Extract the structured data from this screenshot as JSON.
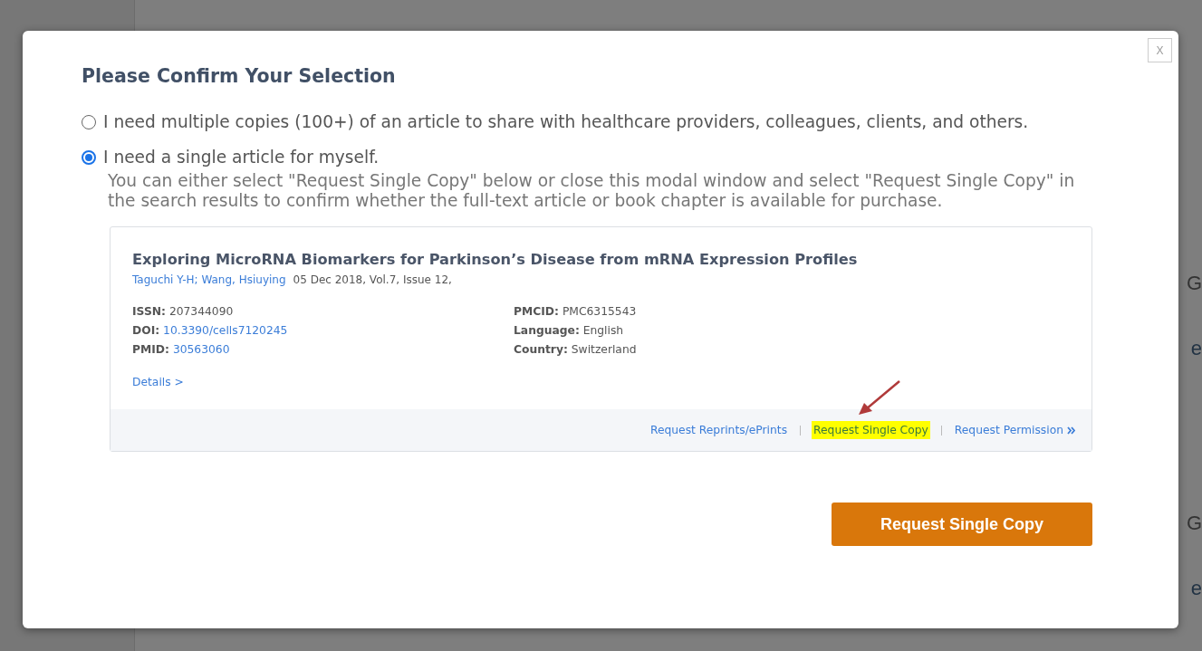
{
  "background_fragments": [
    "G",
    "e",
    "G",
    "e"
  ],
  "close": "X",
  "title": "Please Confirm Your Selection",
  "options": [
    {
      "label": "I need multiple copies (100+) of an article to share with healthcare providers, colleagues, clients, and others.",
      "selected": false
    },
    {
      "label": "I need a single article for myself.",
      "selected": true,
      "description": "You can either select \"Request Single Copy\" below or close this modal window and select \"Request Single Copy\" in the search results to confirm whether the full-text article or book chapter is available for purchase."
    }
  ],
  "article": {
    "title": "Exploring MicroRNA Biomarkers for Parkinson’s Disease from mRNA Expression Profiles",
    "authors": "Taguchi Y-H; Wang, Hsiuying",
    "citation": "05 Dec 2018, Vol.7, Issue 12,",
    "fields_left": [
      {
        "label": "ISSN:",
        "value": "207344090",
        "link": false
      },
      {
        "label": "DOI:",
        "value": "10.3390/cells7120245",
        "link": true
      },
      {
        "label": "PMID:",
        "value": "30563060",
        "link": true
      }
    ],
    "fields_right": [
      {
        "label": "PMCID:",
        "value": "PMC6315543",
        "link": false
      },
      {
        "label": "Language:",
        "value": "English",
        "link": false
      },
      {
        "label": "Country:",
        "value": "Switzerland",
        "link": false
      }
    ],
    "details_link": "Details >",
    "actions": [
      {
        "label": "Request Reprints/ePrints",
        "highlighted": false,
        "chevron": false
      },
      {
        "label": "Request Single Copy",
        "highlighted": true,
        "chevron": false
      },
      {
        "label": "Request Permission",
        "highlighted": false,
        "chevron": true
      }
    ]
  },
  "button": "Request Single Copy"
}
